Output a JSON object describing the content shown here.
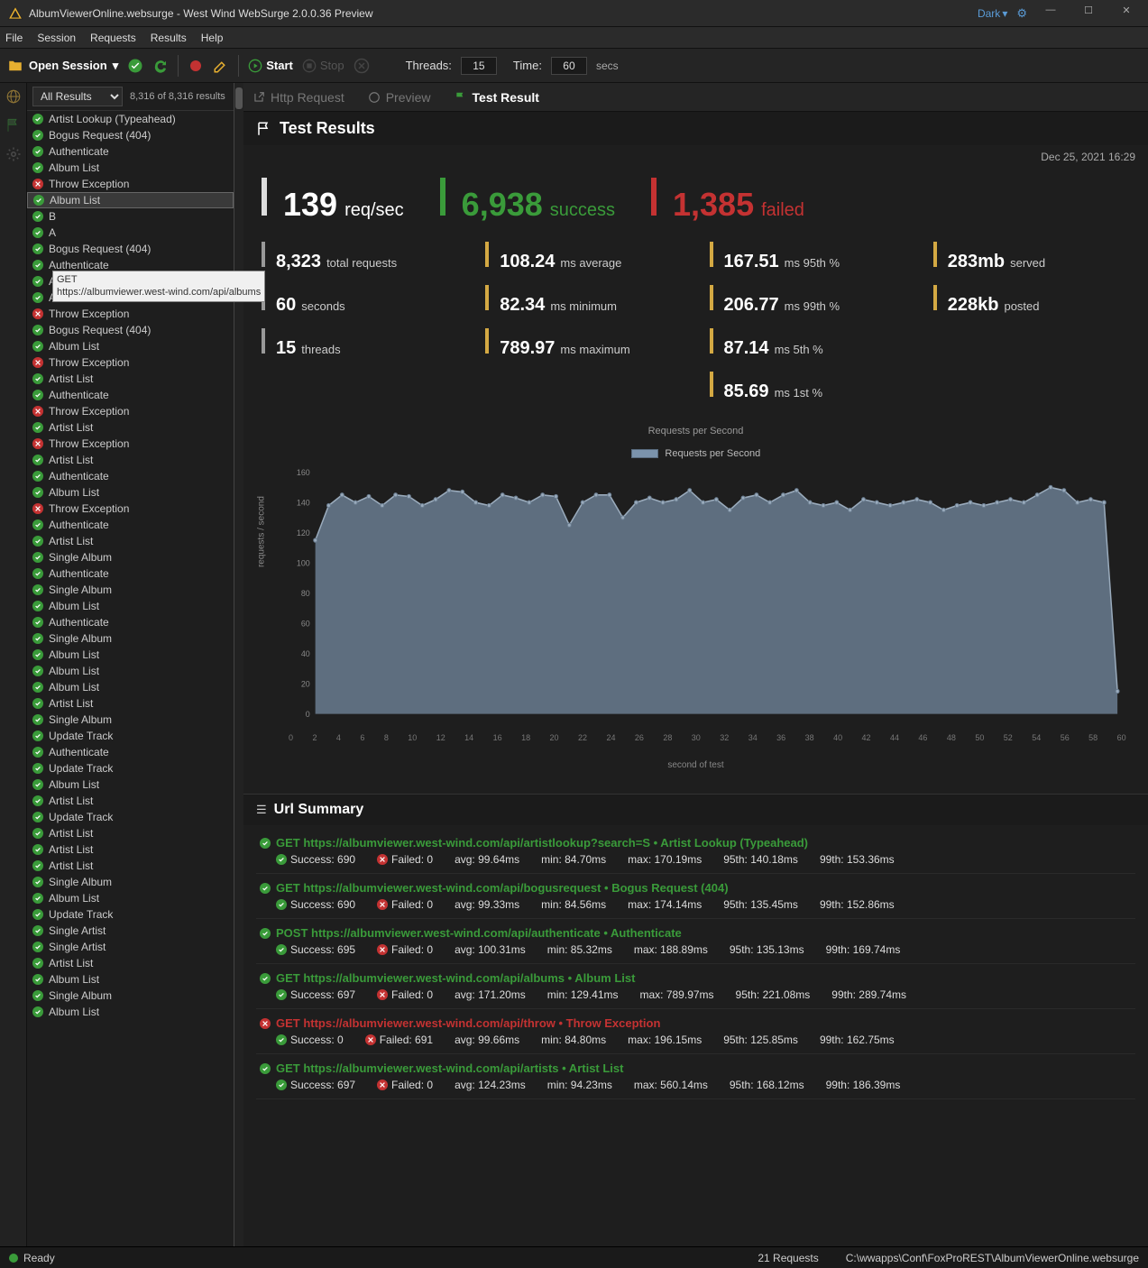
{
  "window": {
    "title": "AlbumViewerOnline.websurge - West Wind WebSurge 2.0.0.36 Preview",
    "theme": "Dark"
  },
  "menu": [
    "File",
    "Session",
    "Requests",
    "Results",
    "Help"
  ],
  "toolbar": {
    "open_session": "Open Session",
    "start": "Start",
    "stop": "Stop",
    "threads_label": "Threads:",
    "threads_val": "15",
    "time_label": "Time:",
    "time_val": "60",
    "secs": "secs"
  },
  "sidebar": {
    "filter": "All Results",
    "count": "8,316 of 8,316 results",
    "tooltip_method": "GET",
    "tooltip_url": "https://albumviewer.west-wind.com/api/albums",
    "items": [
      {
        "label": "Artist Lookup (Typeahead)",
        "ok": true
      },
      {
        "label": "Bogus Request (404)",
        "ok": true
      },
      {
        "label": "Authenticate",
        "ok": true
      },
      {
        "label": "Album List",
        "ok": true
      },
      {
        "label": "Throw Exception",
        "ok": false
      },
      {
        "label": "Album List",
        "ok": true,
        "selected": true
      },
      {
        "label": "B",
        "ok": true
      },
      {
        "label": "A",
        "ok": true
      },
      {
        "label": "Bogus Request (404)",
        "ok": true
      },
      {
        "label": "Authenticate",
        "ok": true
      },
      {
        "label": "Authenticate",
        "ok": true
      },
      {
        "label": "Authenticate",
        "ok": true
      },
      {
        "label": "Throw Exception",
        "ok": false
      },
      {
        "label": "Bogus Request (404)",
        "ok": true
      },
      {
        "label": "Album List",
        "ok": true
      },
      {
        "label": "Throw Exception",
        "ok": false
      },
      {
        "label": "Artist List",
        "ok": true
      },
      {
        "label": "Authenticate",
        "ok": true
      },
      {
        "label": "Throw Exception",
        "ok": false
      },
      {
        "label": "Artist List",
        "ok": true
      },
      {
        "label": "Throw Exception",
        "ok": false
      },
      {
        "label": "Artist List",
        "ok": true
      },
      {
        "label": "Authenticate",
        "ok": true
      },
      {
        "label": "Album List",
        "ok": true
      },
      {
        "label": "Throw Exception",
        "ok": false
      },
      {
        "label": "Authenticate",
        "ok": true
      },
      {
        "label": "Artist List",
        "ok": true
      },
      {
        "label": "Single Album",
        "ok": true
      },
      {
        "label": "Authenticate",
        "ok": true
      },
      {
        "label": "Single Album",
        "ok": true
      },
      {
        "label": "Album List",
        "ok": true
      },
      {
        "label": "Authenticate",
        "ok": true
      },
      {
        "label": "Single Album",
        "ok": true
      },
      {
        "label": "Album List",
        "ok": true
      },
      {
        "label": "Album List",
        "ok": true
      },
      {
        "label": "Album List",
        "ok": true
      },
      {
        "label": "Artist List",
        "ok": true
      },
      {
        "label": "Single Album",
        "ok": true
      },
      {
        "label": "Update Track",
        "ok": true
      },
      {
        "label": "Authenticate",
        "ok": true
      },
      {
        "label": "Update Track",
        "ok": true
      },
      {
        "label": "Album List",
        "ok": true
      },
      {
        "label": "Artist List",
        "ok": true
      },
      {
        "label": "Update Track",
        "ok": true
      },
      {
        "label": "Artist List",
        "ok": true
      },
      {
        "label": "Artist List",
        "ok": true
      },
      {
        "label": "Artist List",
        "ok": true
      },
      {
        "label": "Single Album",
        "ok": true
      },
      {
        "label": "Album List",
        "ok": true
      },
      {
        "label": "Update Track",
        "ok": true
      },
      {
        "label": "Single Artist",
        "ok": true
      },
      {
        "label": "Single Artist",
        "ok": true
      },
      {
        "label": "Artist List",
        "ok": true
      },
      {
        "label": "Album List",
        "ok": true
      },
      {
        "label": "Single Album",
        "ok": true
      },
      {
        "label": "Album List",
        "ok": true
      }
    ]
  },
  "tabs": {
    "http_request": "Http Request",
    "preview": "Preview",
    "test_result": "Test Result"
  },
  "results": {
    "header": "Test Results",
    "timestamp": "Dec 25, 2021 16:29",
    "big": [
      {
        "val": "139",
        "label": "req/sec",
        "color": "white"
      },
      {
        "val": "6,938",
        "label": "success",
        "color": "green"
      },
      {
        "val": "1,385",
        "label": "failed",
        "color": "red"
      }
    ],
    "small": [
      {
        "val": "8,323",
        "label": "total requests",
        "gray": true
      },
      {
        "val": "108.24",
        "label": "ms average"
      },
      {
        "val": "167.51",
        "label": "ms 95th %"
      },
      {
        "val": "283mb",
        "label": "served"
      },
      {
        "val": "60",
        "label": "seconds",
        "gray": true
      },
      {
        "val": "82.34",
        "label": "ms minimum"
      },
      {
        "val": "206.77",
        "label": "ms 99th %"
      },
      {
        "val": "228kb",
        "label": "posted"
      },
      {
        "val": "15",
        "label": "threads",
        "gray": true
      },
      {
        "val": "789.97",
        "label": "ms maximum"
      },
      {
        "val": "87.14",
        "label": "ms 5th %"
      },
      {
        "val": "",
        "label": ""
      },
      {
        "val": "",
        "label": ""
      },
      {
        "val": "",
        "label": ""
      },
      {
        "val": "85.69",
        "label": "ms 1st %"
      }
    ]
  },
  "chart_data": {
    "type": "area",
    "title": "Requests per Second",
    "legend": "Requests per Second",
    "xlabel": "second of test",
    "ylabel": "requests / second",
    "ylim": [
      0,
      160
    ],
    "x": [
      0,
      1,
      2,
      3,
      4,
      5,
      6,
      7,
      8,
      9,
      10,
      11,
      12,
      13,
      14,
      15,
      16,
      17,
      18,
      19,
      20,
      21,
      22,
      23,
      24,
      25,
      26,
      27,
      28,
      29,
      30,
      31,
      32,
      33,
      34,
      35,
      36,
      37,
      38,
      39,
      40,
      41,
      42,
      43,
      44,
      45,
      46,
      47,
      48,
      49,
      50,
      51,
      52,
      53,
      54,
      55,
      56,
      57,
      58,
      59,
      60
    ],
    "y": [
      115,
      138,
      145,
      140,
      144,
      138,
      145,
      144,
      138,
      142,
      148,
      147,
      140,
      138,
      145,
      143,
      140,
      145,
      144,
      125,
      140,
      145,
      145,
      130,
      140,
      143,
      140,
      142,
      148,
      140,
      142,
      135,
      143,
      145,
      140,
      145,
      148,
      140,
      138,
      140,
      135,
      142,
      140,
      138,
      140,
      142,
      140,
      135,
      138,
      140,
      138,
      140,
      142,
      140,
      145,
      150,
      148,
      140,
      142,
      140,
      15
    ],
    "xticks": [
      0,
      2,
      4,
      6,
      8,
      10,
      12,
      14,
      16,
      18,
      20,
      22,
      24,
      26,
      28,
      30,
      32,
      34,
      36,
      38,
      40,
      42,
      44,
      46,
      48,
      50,
      52,
      54,
      56,
      58,
      60
    ]
  },
  "url_summary": {
    "header": "Url Summary",
    "items": [
      {
        "ok": true,
        "method": "GET",
        "url": "https://albumviewer.west-wind.com/api/artistlookup?search=S",
        "name": "Artist Lookup (Typeahead)",
        "success": 690,
        "failed": 0,
        "avg": "99.64ms",
        "min": "84.70ms",
        "max": "170.19ms",
        "p95": "140.18ms",
        "p99": "153.36ms"
      },
      {
        "ok": true,
        "method": "GET",
        "url": "https://albumviewer.west-wind.com/api/bogusrequest",
        "name": "Bogus Request (404)",
        "success": 690,
        "failed": 0,
        "avg": "99.33ms",
        "min": "84.56ms",
        "max": "174.14ms",
        "p95": "135.45ms",
        "p99": "152.86ms"
      },
      {
        "ok": true,
        "method": "POST",
        "url": "https://albumviewer.west-wind.com/api/authenticate",
        "name": "Authenticate",
        "success": 695,
        "failed": 0,
        "avg": "100.31ms",
        "min": "85.32ms",
        "max": "188.89ms",
        "p95": "135.13ms",
        "p99": "169.74ms"
      },
      {
        "ok": true,
        "method": "GET",
        "url": "https://albumviewer.west-wind.com/api/albums",
        "name": "Album List",
        "success": 697,
        "failed": 0,
        "avg": "171.20ms",
        "min": "129.41ms",
        "max": "789.97ms",
        "p95": "221.08ms",
        "p99": "289.74ms"
      },
      {
        "ok": false,
        "method": "GET",
        "url": "https://albumviewer.west-wind.com/api/throw",
        "name": "Throw Exception",
        "success": 0,
        "failed": 691,
        "avg": "99.66ms",
        "min": "84.80ms",
        "max": "196.15ms",
        "p95": "125.85ms",
        "p99": "162.75ms"
      },
      {
        "ok": true,
        "method": "GET",
        "url": "https://albumviewer.west-wind.com/api/artists",
        "name": "Artist List",
        "success": 697,
        "failed": 0,
        "avg": "124.23ms",
        "min": "94.23ms",
        "max": "560.14ms",
        "p95": "168.12ms",
        "p99": "186.39ms"
      }
    ]
  },
  "statusbar": {
    "ready": "Ready",
    "requests": "21 Requests",
    "path": "C:\\wwapps\\Conf\\FoxProREST\\AlbumViewerOnline.websurge"
  }
}
